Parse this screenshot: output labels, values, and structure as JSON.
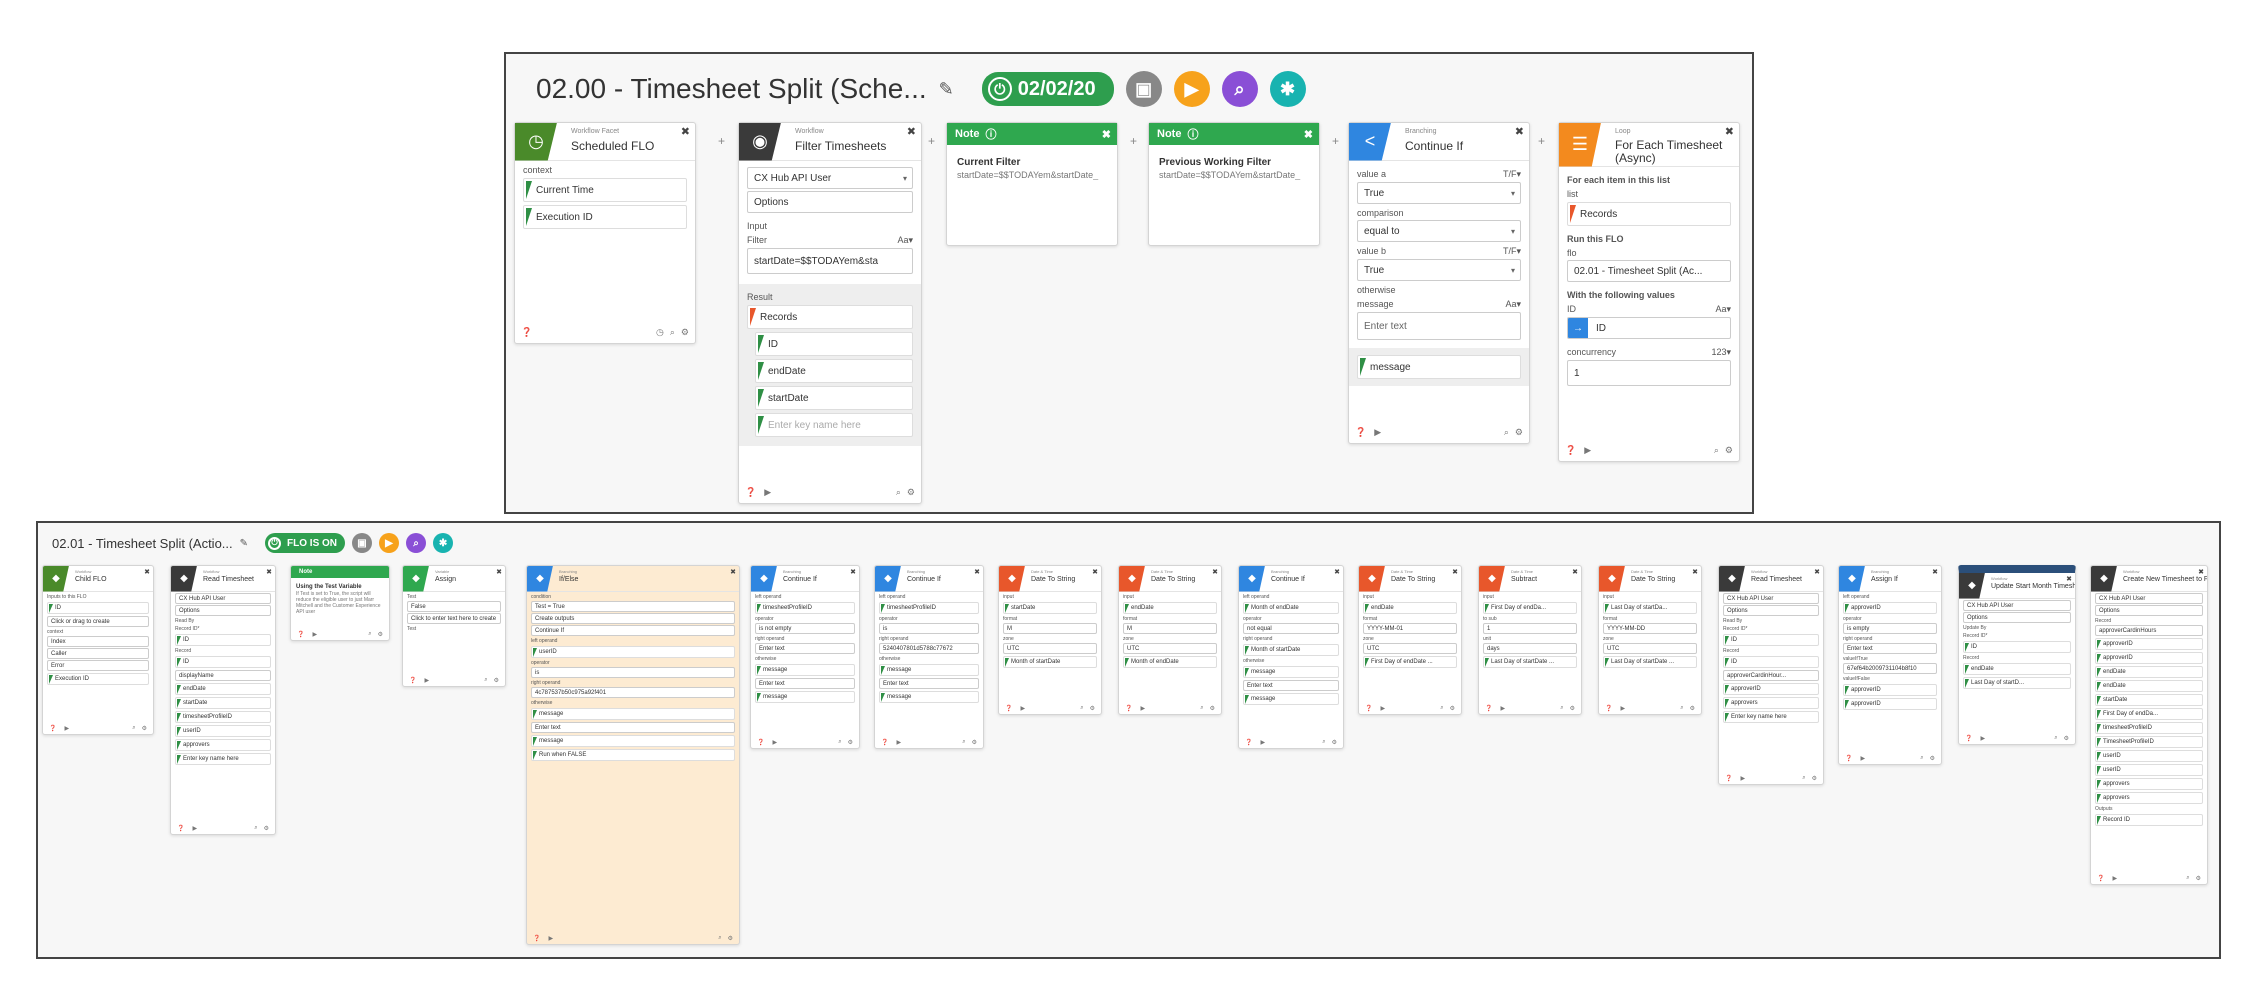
{
  "top": {
    "title": "02.00 - Timesheet Split (Sche...",
    "status": "02/02/20",
    "cards": {
      "scheduled": {
        "sub": "Workflow Facet",
        "name": "Scheduled FLO",
        "context_label": "context",
        "fields": [
          "Current Time",
          "Execution ID"
        ]
      },
      "filter": {
        "sub": "Workflow",
        "name": "Filter Timesheets",
        "api_user": "CX Hub API User",
        "options": "Options",
        "input_label": "Input",
        "filter_label": "Filter",
        "filter_type": "Aa▾",
        "filter_value": "startDate=$$TODAYem&sta",
        "result_label": "Result",
        "records": "Records",
        "result_fields": [
          "ID",
          "endDate",
          "startDate"
        ],
        "key_placeholder": "Enter key name here"
      },
      "note1": {
        "head": "Note",
        "title": "Current Filter",
        "text": "startDate=$$TODAYem&startDate_"
      },
      "note2": {
        "head": "Note",
        "title": "Previous Working Filter",
        "text": "startDate=$$TODAYem&startDate_"
      },
      "continue_if": {
        "sub": "Branching",
        "name": "Continue If",
        "value_a_label": "value a",
        "value_a_type": "T/F▾",
        "value_a": "True",
        "comparison_label": "comparison",
        "comparison": "equal to",
        "value_b_label": "value b",
        "value_b_type": "T/F▾",
        "value_b": "True",
        "otherwise": "otherwise",
        "message_label": "message",
        "message_type": "Aa▾",
        "message_placeholder": "Enter text",
        "output": "message"
      },
      "foreach": {
        "sub": "Loop",
        "name": "For Each Timesheet (Async)",
        "list_heading": "For each item in this list",
        "list_label": "list",
        "records": "Records",
        "run_heading": "Run this FLO",
        "flo_label": "flo",
        "flo_value": "02.01 - Timesheet Split (Ac...",
        "values_heading": "With the following values",
        "id_label": "ID",
        "id_type": "Aa▾",
        "id_value": "ID",
        "concurrency_label": "concurrency",
        "concurrency_type": "123▾",
        "concurrency_value": "1"
      }
    }
  },
  "bottom": {
    "title": "02.01 - Timesheet Split (Actio...",
    "status": "FLO IS ON",
    "cards": [
      {
        "sub": "Workflow",
        "name": "Child FLO",
        "lines": [
          "Inputs to this FLO",
          "ID",
          "Click or drag to create",
          "context",
          "Index",
          "Caller",
          "Error",
          "Execution ID"
        ]
      },
      {
        "sub": "Workflow",
        "name": "Read Timesheet",
        "lines": [
          "CX Hub API User",
          "Options",
          "Read By",
          "Record ID*",
          "ID",
          "Record",
          "ID",
          "displayName",
          "endDate",
          "startDate",
          "timesheetProfileID",
          "userID",
          "approvers",
          "Enter key name here"
        ]
      },
      {
        "note": "Note",
        "title": "Using the Test Variable",
        "text": "If Test is set to True, the script will reduce the eligible user to just Marr Mitchell and the Customer Experience API user"
      },
      {
        "sub": "Variable",
        "name": "Assign",
        "lines": [
          "Test",
          "False",
          "Click to enter text here to create",
          "Test"
        ]
      },
      {
        "sub": "Branching",
        "name": "If/Else",
        "lines": [
          "condition",
          "Test = True",
          "Create outputs",
          "Continue If",
          "left operand",
          "userID",
          "operator",
          "is",
          "right operand",
          "4c787537b50c975a92f401",
          "otherwise",
          "message",
          "Enter text",
          "message",
          "Run when FALSE"
        ]
      },
      {
        "sub": "Branching",
        "name": "Continue If",
        "lines": [
          "left operand",
          "timesheetProfileID",
          "operator",
          "is not empty",
          "right operand",
          "Enter text",
          "otherwise",
          "message",
          "Enter text",
          "message"
        ]
      },
      {
        "sub": "Branching",
        "name": "Continue If",
        "lines": [
          "left operand",
          "timesheetProfileID",
          "operator",
          "is",
          "right operand",
          "5240407801d5788c77672",
          "otherwise",
          "message",
          "Enter text",
          "message"
        ]
      },
      {
        "sub": "Date & Time",
        "name": "Date To String",
        "lines": [
          "input",
          "startDate",
          "format",
          "M",
          "zone",
          "UTC",
          "Month of startDate"
        ]
      },
      {
        "sub": "Date & Time",
        "name": "Date To String",
        "lines": [
          "input",
          "endDate",
          "format",
          "M",
          "zone",
          "UTC",
          "Month of endDate"
        ]
      },
      {
        "sub": "Branching",
        "name": "Continue If",
        "lines": [
          "left operand",
          "Month of endDate",
          "operator",
          "not equal",
          "right operand",
          "Month of startDate",
          "otherwise",
          "message",
          "Enter text",
          "message"
        ]
      },
      {
        "sub": "Date & Time",
        "name": "Date To String",
        "lines": [
          "input",
          "endDate",
          "format",
          "YYYY-MM-01",
          "zone",
          "UTC",
          "First Day of endDate ..."
        ]
      },
      {
        "sub": "Date & Time",
        "name": "Subtract",
        "lines": [
          "input",
          "First Day of endDa...",
          "to sub",
          "1",
          "unit",
          "days",
          "Last Day of startDate ..."
        ]
      },
      {
        "sub": "Date & Time",
        "name": "Date To String",
        "lines": [
          "input",
          "Last Day of startDa...",
          "format",
          "YYYY-MM-DD",
          "zone",
          "UTC",
          "Last Day of startDate ..."
        ]
      },
      {
        "sub": "Workflow",
        "name": "Read Timesheet",
        "lines": [
          "CX Hub API User",
          "Options",
          "Read By",
          "Record ID*",
          "ID",
          "Record",
          "ID",
          "approverCardinHour...",
          "approverID",
          "approvers",
          "Enter key name here"
        ]
      },
      {
        "sub": "Branching",
        "name": "Assign If",
        "lines": [
          "left operand",
          "approverID",
          "operator",
          "is empty",
          "right operand",
          "Enter text",
          "valueIfTrue",
          "67ef64b2009731104b8f10",
          "valueIfFalse",
          "approverID",
          "approverID"
        ]
      },
      {
        "sub": "Workflow",
        "name": "Update Start Month Timesheet",
        "lines": [
          "CX Hub API User",
          "Options",
          "Update By",
          "Record ID*",
          "ID",
          "Record",
          "endDate",
          "Last Day of startD..."
        ]
      },
      {
        "sub": "Workflow",
        "name": "Create New Timesheet to Fill...",
        "lines": [
          "CX Hub API User",
          "Options",
          "Record",
          "approverCardinHours",
          "approverID",
          "approverID",
          "endDate",
          "endDate",
          "startDate",
          "First Day of endDa...",
          "timesheetProfileID",
          "TimesheetProfileID",
          "userID",
          "userID",
          "approvers",
          "approvers",
          "Outputs",
          "Record ID"
        ]
      }
    ]
  }
}
